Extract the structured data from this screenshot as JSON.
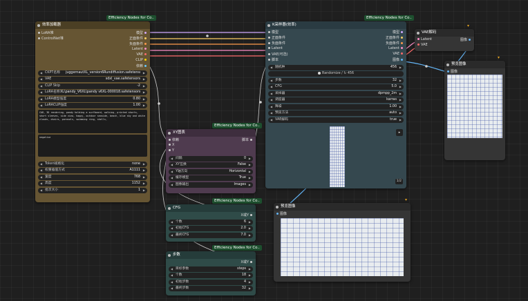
{
  "colors": {
    "model": "#d1a9ff",
    "cond_pos": "#ffd166",
    "cond_neg": "#ff9a4a",
    "latent": "#ff8fc8",
    "vae": "#ff6b6b",
    "clip": "#ffd500",
    "dep": "#66ccff",
    "script": "#cfcfcf",
    "image": "#64b5f6"
  },
  "loader": {
    "badge": "Efficiency Nodes for Co..",
    "title": "效率加载器",
    "inputs": [
      "LoRA堆",
      "ControlNet堆"
    ],
    "outputs": [
      "模型",
      "正面条件",
      "负面条件",
      "Latent",
      "VAE",
      "CLIP",
      "依赖"
    ],
    "widgets": [
      {
        "label": "CKPT名称",
        "value": "juggernautXL_version6Rundiffusion.safetensors"
      },
      {
        "label": "VAE",
        "value": "sdxl_vae.safetensors"
      },
      {
        "label": "CLIP Skip",
        "value": "-2"
      },
      {
        "label": "LoRA名称",
        "value": "XL\\pandy_V6XL\\pandy v6XL-000018.safetensors"
      },
      {
        "label": "LoRA模型强度",
        "value": "0.80"
      },
      {
        "label": "LoRACLIP强度",
        "value": "1.00"
      }
    ],
    "positive": "CAD, 3D rendering, pandy holding a surfboard, walking, printed shorts, short sleeves, side view, happy, outdoor seaside, beach, blue sky and white clouds, chairs, parasols, swimming ring, shells,",
    "negative": "negative",
    "widgets2": [
      {
        "label": "Token规格化",
        "value": "none"
      },
      {
        "label": "权重插值方式",
        "value": "A1111"
      },
      {
        "label": "宽度",
        "value": "768"
      },
      {
        "label": "高度",
        "value": "1152"
      },
      {
        "label": "批次大小",
        "value": "1"
      }
    ]
  },
  "ksampler": {
    "badge": "Efficiency Nodes for Co..",
    "title": "K采样器(效率)",
    "inputs": [
      "模型",
      "正面条件",
      "负面条件",
      "Latent",
      "VAE(可选)",
      "脚本"
    ],
    "outputs": [
      "模型",
      "正面条件",
      "负面条件",
      "Latent",
      "VAE",
      "图像"
    ],
    "widgets": [
      {
        "label": "随机种",
        "value": "456"
      }
    ],
    "randomize": "Randomize / ↻ 456",
    "widgets2": [
      {
        "label": "步数",
        "value": "32"
      },
      {
        "label": "CFG",
        "value": "5.0"
      },
      {
        "label": "采样器",
        "value": "dpmpp_2m"
      },
      {
        "label": "调度器",
        "value": "karras"
      },
      {
        "label": "降噪",
        "value": "1.00"
      },
      {
        "label": "预览方法",
        "value": "auto"
      },
      {
        "label": "VAE解码",
        "value": "true"
      }
    ],
    "page": "1/2"
  },
  "xy": {
    "badge": "Efficiency Nodes for Co..",
    "title": "XY图表",
    "inputs": [
      "依赖",
      "X",
      "Y"
    ],
    "output": "脚本",
    "widgets": [
      {
        "label": "间隔",
        "value": "0"
      },
      {
        "label": "XY互换",
        "value": "False"
      },
      {
        "label": "Y轴方向",
        "value": "Horizontal"
      },
      {
        "label": "缓存模型",
        "value": "True"
      },
      {
        "label": "图像输出",
        "value": "Images"
      }
    ]
  },
  "cfg": {
    "badge": "Efficiency Nodes for Co..",
    "title": "CFG",
    "output": "X或Y",
    "widgets": [
      {
        "label": "个数",
        "value": "6"
      },
      {
        "label": "初始CFG",
        "value": "2.0"
      },
      {
        "label": "最终CFG",
        "value": "7.0"
      }
    ]
  },
  "steps": {
    "badge": "Efficiency Nodes for Co..",
    "title": "步数",
    "output": "X或Y",
    "widgets": [
      {
        "label": "目标参数",
        "value": "steps"
      },
      {
        "label": "个数",
        "value": "18"
      },
      {
        "label": "初始步数",
        "value": "4"
      },
      {
        "label": "最终步数",
        "value": "32"
      }
    ]
  },
  "vaedecode": {
    "title": "VAE解码",
    "inputs": [
      "Latent",
      "VAE"
    ],
    "output": "图像"
  },
  "preview1": {
    "title": "预览图像",
    "input": "图像"
  },
  "preview2": {
    "title": "预览图像",
    "input": "图像"
  }
}
